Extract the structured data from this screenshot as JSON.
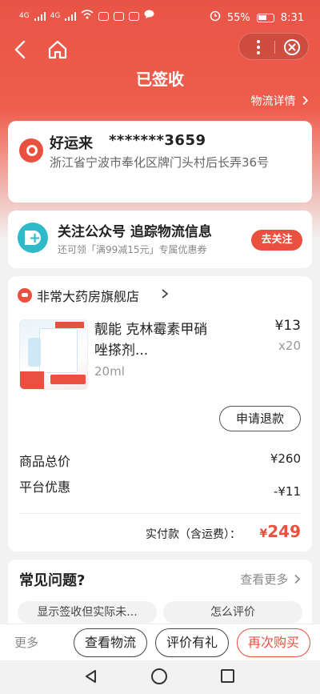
{
  "status_bar": {
    "battery": "55%",
    "time": "8:31",
    "net1": "4G",
    "net2": "4G"
  },
  "header": {
    "title": "已签收",
    "logistics_link": "物流详情"
  },
  "address": {
    "name": "好运来",
    "phone": "*******3659",
    "address": "浙江省宁波市奉化区牌门头村后长弄36号"
  },
  "follow": {
    "title": "关注公众号 追踪物流信息",
    "subtitle": "还可领「满99减15元」专属优惠券",
    "button": "去关注"
  },
  "order": {
    "store": "非常大药房旗舰店",
    "product_name": "靓能 克林霉素甲硝唑搽剂...",
    "spec": "20ml",
    "price": "¥13",
    "qty": "x20",
    "refund_button": "申请退款",
    "total_label": "商品总价",
    "total_value": "¥260",
    "discount_label": "平台优惠",
    "discount_value": "-¥11",
    "paid_label": "实付款（含运费）：",
    "paid_currency": "¥",
    "paid_value": "249"
  },
  "faq": {
    "title": "常见问题?",
    "more": "查看更多",
    "chips": [
      "显示签收但实际未...",
      "怎么评价"
    ]
  },
  "bottom_bar": {
    "more": "更多",
    "buttons": [
      "查看物流",
      "评价有礼",
      "再次购买"
    ]
  },
  "colors": {
    "accent": "#e9503f",
    "teal": "#2fbac9"
  }
}
